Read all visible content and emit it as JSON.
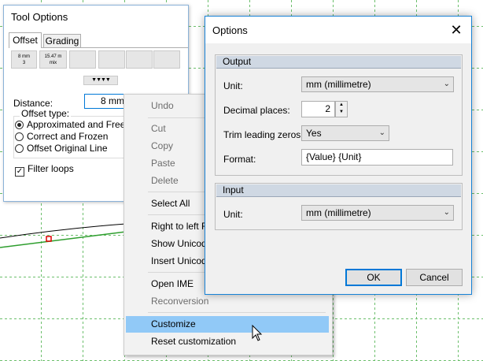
{
  "tool_options": {
    "title": "Tool Options",
    "tabs": [
      "Offset",
      "Grading"
    ],
    "presets": [
      "8 mm\n3",
      "15.47 m\nmix"
    ],
    "preset_arrows": "▼▼▼▼",
    "distance_label": "Distance:",
    "distance_value": "8 mm",
    "offset_type_label": "Offset type:",
    "offset_types": [
      "Approximated and Free",
      "Correct and Frozen",
      "Offset Original Line"
    ],
    "filter_loops_label": "Filter loops"
  },
  "context_menu": {
    "items": [
      {
        "label": "Undo",
        "enabled": false
      },
      {
        "label": "Cut",
        "enabled": false
      },
      {
        "label": "Copy",
        "enabled": false
      },
      {
        "label": "Paste",
        "enabled": false
      },
      {
        "label": "Delete",
        "enabled": false
      },
      {
        "label": "Select All",
        "enabled": true
      },
      {
        "label": "Right to left R",
        "enabled": true
      },
      {
        "label": "Show Unicod",
        "enabled": true
      },
      {
        "label": "Insert Unicod",
        "enabled": true
      },
      {
        "label": "Open IME",
        "enabled": true
      },
      {
        "label": "Reconversion",
        "enabled": false
      },
      {
        "label": "Customize",
        "enabled": true
      },
      {
        "label": "Reset customization",
        "enabled": true
      }
    ]
  },
  "options_dialog": {
    "title": "Options",
    "output": {
      "header": "Output",
      "unit_label": "Unit:",
      "unit_value": "mm (millimetre)",
      "decimals_label": "Decimal places:",
      "decimals_value": "2",
      "trim_label": "Trim leading zeros:",
      "trim_value": "Yes",
      "format_label": "Format:",
      "format_value": "{Value} {Unit}"
    },
    "input": {
      "header": "Input",
      "unit_label": "Unit:",
      "unit_value": "mm (millimetre)"
    },
    "ok_label": "OK",
    "cancel_label": "Cancel"
  },
  "colors": {
    "accent": "#0078d7",
    "menu_highlight": "#91c9f7",
    "group_header": "#cfd8e3",
    "grid": "#6cbf6c"
  }
}
